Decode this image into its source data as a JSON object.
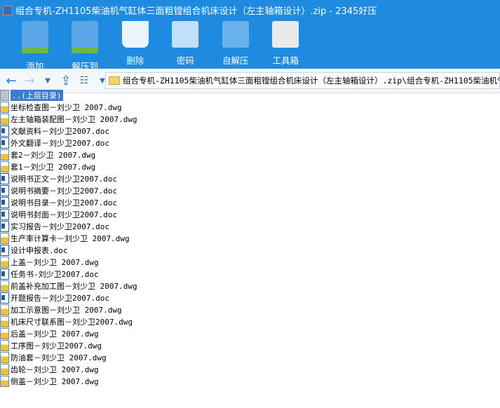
{
  "window": {
    "title": "组合专机-ZH1105柴油机气缸体三面粗镗组合机床设计（左主轴箱设计）.zip - 2345好压"
  },
  "toolbar": [
    {
      "label": "添加",
      "icon": "add-archive-icon"
    },
    {
      "label": "解压到",
      "icon": "extract-icon"
    },
    {
      "label": "删除",
      "icon": "recycle-bin-icon"
    },
    {
      "label": "密码",
      "icon": "lock-icon"
    },
    {
      "label": "自解压",
      "icon": "self-extract-icon"
    },
    {
      "label": "工具箱",
      "icon": "toolbox-icon"
    }
  ],
  "address": "组合专机-ZH1105柴油机气缸体三面粗镗组合机床设计（左主轴箱设计）.zip\\组合专机-ZH1105柴油机气",
  "parent": "..(上层目录)",
  "files": [
    {
      "name": "坐标检查图－刘少卫 2007.dwg",
      "type": "dwg"
    },
    {
      "name": "左主轴箱装配图－刘少卫 2007.dwg",
      "type": "dwg"
    },
    {
      "name": "文献资料－刘少卫2007.doc",
      "type": "doc"
    },
    {
      "name": "外文翻译－刘少卫2007.doc",
      "type": "doc"
    },
    {
      "name": "套2－刘少卫 2007.dwg",
      "type": "dwg"
    },
    {
      "name": "套1－刘少卫 2007.dwg",
      "type": "dwg"
    },
    {
      "name": "说明书正文－刘少卫2007.doc",
      "type": "doc"
    },
    {
      "name": "说明书摘要－刘少卫2007.doc",
      "type": "doc"
    },
    {
      "name": "说明书目录－刘少卫2007.doc",
      "type": "doc"
    },
    {
      "name": "说明书封面－刘少卫2007.doc",
      "type": "doc"
    },
    {
      "name": "实习报告－刘少卫2007.doc",
      "type": "doc"
    },
    {
      "name": "生产率计算卡－刘少卫 2007.dwg",
      "type": "dwg"
    },
    {
      "name": "设计申报表.doc",
      "type": "doc"
    },
    {
      "name": "上盖－刘少卫 2007.dwg",
      "type": "dwg"
    },
    {
      "name": "任务书-刘少卫2007.doc",
      "type": "doc"
    },
    {
      "name": "前盖补充加工图－刘少卫 2007.dwg",
      "type": "dwg"
    },
    {
      "name": "开题报告－刘少卫2007.doc",
      "type": "doc"
    },
    {
      "name": "加工示意图－刘少卫 2007.dwg",
      "type": "dwg"
    },
    {
      "name": "机床尺寸联系图－刘少卫2007.dwg",
      "type": "dwg"
    },
    {
      "name": "后盖－刘少卫 2007.dwg",
      "type": "dwg"
    },
    {
      "name": "工序图－刘少卫2007.dwg",
      "type": "dwg"
    },
    {
      "name": "防油套－刘少卫 2007.dwg",
      "type": "dwg"
    },
    {
      "name": "齿轮－刘少卫 2007.dwg",
      "type": "dwg"
    },
    {
      "name": "侧盖－刘少卫 2007.dwg",
      "type": "dwg"
    }
  ],
  "colors": {
    "titlebar": "#1e8ae0",
    "selection": "#3a7bd5"
  }
}
